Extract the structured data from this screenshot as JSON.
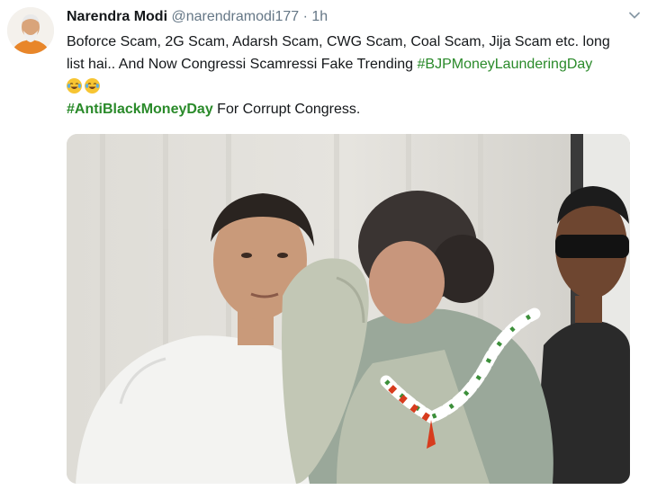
{
  "tweet": {
    "author_name": "Narendra Modi",
    "handle": "@narendramodi177",
    "separator": "·",
    "time": "1h",
    "text_line1": "Boforce Scam, 2G Scam, Adarsh Scam, CWG Scam, Coal Scam, Jija Scam etc. long",
    "text_line2_pre": "list hai.. And Now Congressi Scamressi Fake Trending ",
    "hashtag1": "#BJPMoneyLaunderingDay",
    "emojis": [
      "face-with-tears-of-joy",
      "face-with-tears-of-joy"
    ],
    "hashtag2": "#AntiBlackMoneyDay",
    "text_line4_post": " For Corrupt Congress."
  },
  "colors": {
    "hashtag": "#2a8a2a",
    "name": "#14171a",
    "meta": "#657786"
  },
  "icons": {
    "avatar": "profile-photo",
    "menu": "chevron-down-icon"
  },
  "media": {
    "type": "photo"
  }
}
